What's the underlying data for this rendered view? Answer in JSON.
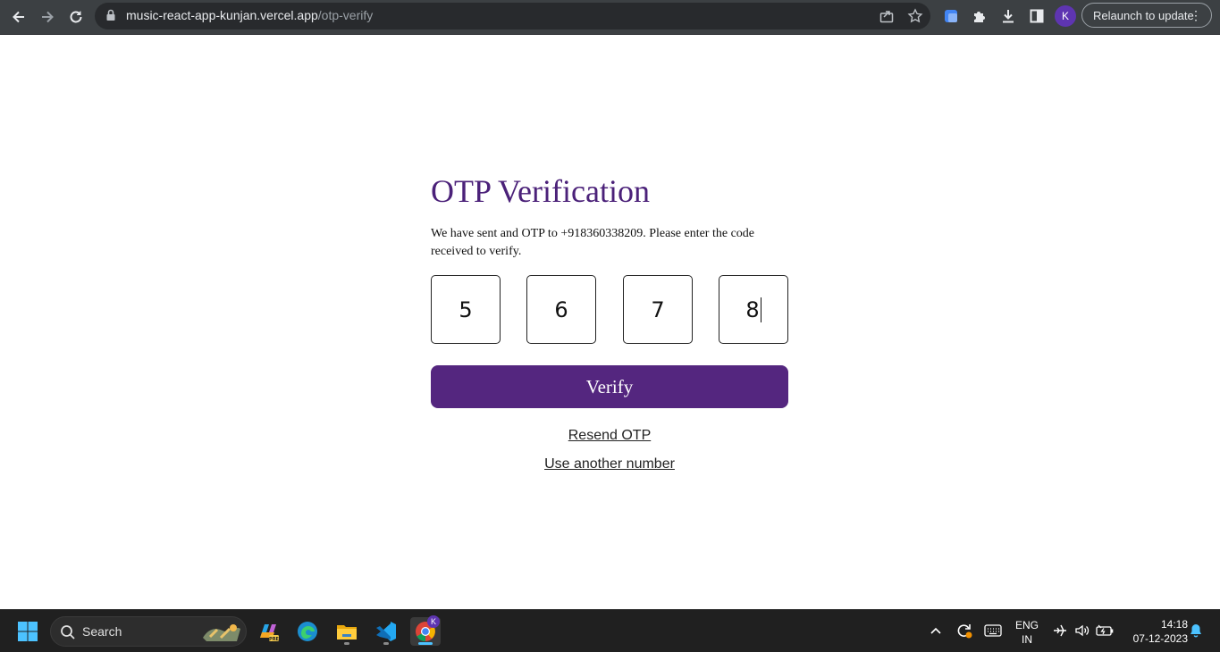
{
  "browser": {
    "url_host": "music-react-app-kunjan.vercel.app",
    "url_path": "/otp-verify",
    "profile_initial": "K",
    "relaunch_label": "Relaunch to update",
    "icons": [
      "back-arrow-icon",
      "forward-arrow-icon",
      "reload-icon",
      "lock-icon",
      "share-icon",
      "star-icon",
      "extension-icon",
      "puzzle-icon",
      "download-icon",
      "side-panel-icon",
      "more-vert-icon"
    ]
  },
  "page": {
    "title": "OTP Verification",
    "description": "We have sent and OTP to +918360338209. Please enter the code received to verify.",
    "otp_digits": [
      "5",
      "6",
      "7",
      "8"
    ],
    "verify_label": "Verify",
    "resend_label": "Resend OTP",
    "another_number_label": "Use another number",
    "colors": {
      "accent": "#54267f",
      "title": "#4b2179"
    }
  },
  "taskbar": {
    "search_placeholder": "Search",
    "apps": [
      "windows-start-icon",
      "copilot-icon",
      "edge-icon",
      "file-explorer-icon",
      "vscode-icon",
      "chrome-icon"
    ],
    "chrome_badge": "K",
    "language": "ENG",
    "region": "IN",
    "time": "14:18",
    "date": "07-12-2023"
  }
}
